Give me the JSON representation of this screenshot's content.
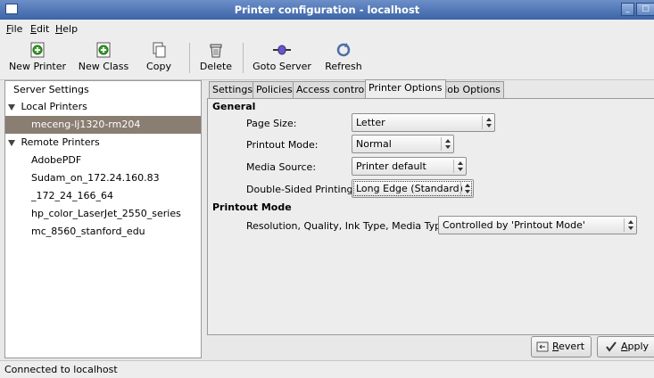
{
  "window": {
    "title": "Printer configuration - localhost"
  },
  "menu": [
    {
      "accel": "F",
      "rest": "ile"
    },
    {
      "accel": "E",
      "rest": "dit"
    },
    {
      "accel": "H",
      "rest": "elp"
    }
  ],
  "toolbar": {
    "new_printer": "New Printer",
    "new_class": "New Class",
    "copy": "Copy",
    "delete": "Delete",
    "goto_server": "Goto Server",
    "refresh": "Refresh"
  },
  "tree": {
    "server_settings": "Server Settings",
    "local_printers": "Local Printers",
    "local_items": [
      "meceng-lj1320-rm204"
    ],
    "remote_printers": "Remote Printers",
    "remote_items": [
      "AdobePDF",
      "Sudam_on_172.24.160.83",
      "_172_24_166_64",
      "hp_color_LaserJet_2550_series",
      "mc_8560_stanford_edu"
    ]
  },
  "tabs": [
    "Settings",
    "Policies",
    "Access control",
    "Printer Options",
    "Job Options"
  ],
  "options": {
    "general_title": "General",
    "page_size": {
      "label": "Page Size:",
      "value": "Letter"
    },
    "printout_mode": {
      "label": "Printout Mode:",
      "value": "Normal"
    },
    "media_source": {
      "label": "Media Source:",
      "value": "Printer default"
    },
    "double_sided": {
      "label": "Double-Sided Printing:",
      "value": "Long Edge (Standard)"
    },
    "printout_title": "Printout Mode",
    "resolution": {
      "label": "Resolution, Quality, Ink Type, Media Type:",
      "value": "Controlled by 'Printout Mode'"
    }
  },
  "buttons": {
    "revert": {
      "accel": "R",
      "rest": "evert"
    },
    "apply": {
      "accel": "A",
      "rest": "pply"
    }
  },
  "status": "Connected to localhost",
  "colors": {
    "selection": "#8a7d72",
    "titlebar": "#3c64a8"
  }
}
